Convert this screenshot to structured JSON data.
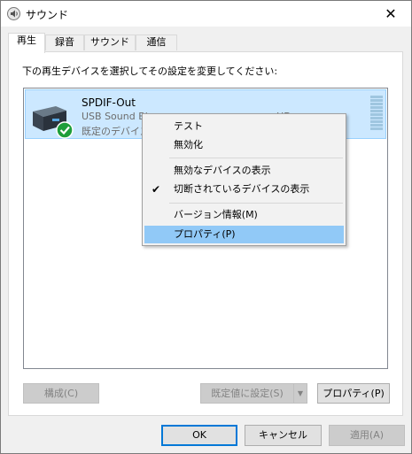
{
  "window": {
    "title": "サウンド",
    "close_glyph": "✕"
  },
  "tabs": [
    {
      "label": "再生",
      "active": true
    },
    {
      "label": "録音",
      "active": false
    },
    {
      "label": "サウンド",
      "active": false
    },
    {
      "label": "通信",
      "active": false
    }
  ],
  "playback": {
    "instruction": "下の再生デバイスを選択してその設定を変更してください:",
    "device": {
      "name": "SPDIF-Out",
      "subtitle": "USB Sound Bl",
      "subtitle_tail": "HD",
      "status": "既定のデバイス",
      "icon": "speaker-device-icon",
      "badge_icon": "default-check-icon"
    }
  },
  "context_menu": {
    "items": [
      {
        "label": "テスト"
      },
      {
        "label": "無効化"
      },
      {
        "label": "無効なデバイスの表示"
      },
      {
        "label": "切断されているデバイスの表示",
        "checked": true
      },
      {
        "label": "バージョン情報(M)"
      },
      {
        "label": "プロパティ(P)",
        "highlighted": true
      }
    ]
  },
  "panel_buttons": {
    "configure": "構成(C)",
    "set_default": "既定値に設定(S)",
    "properties": "プロパティ(P)"
  },
  "dialog_buttons": {
    "ok": "OK",
    "cancel": "キャンセル",
    "apply": "適用(A)"
  },
  "colors": {
    "selection": "#cce8ff",
    "menu_highlight": "#91c9f7",
    "accent": "#0078d7",
    "check_badge": "#1e9e3a"
  }
}
